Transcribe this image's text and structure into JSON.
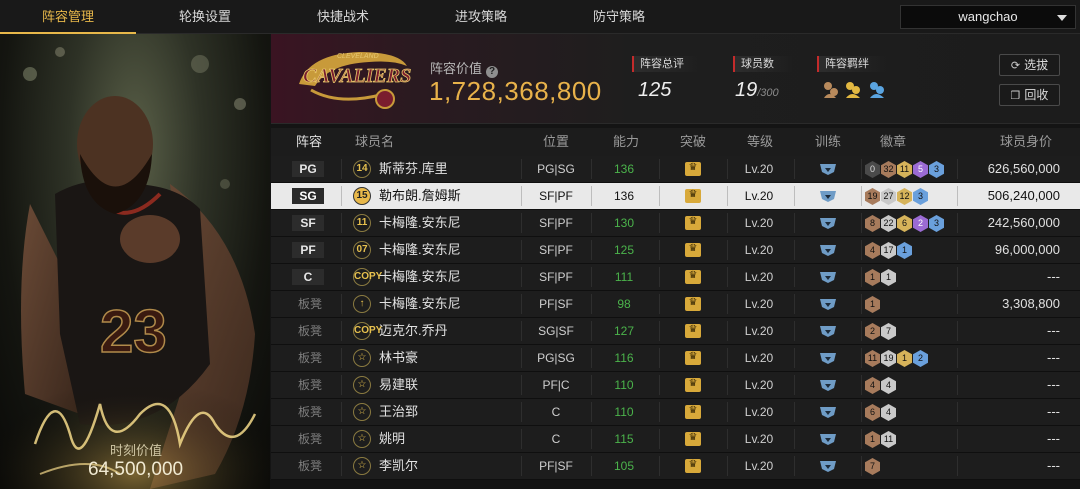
{
  "nav": {
    "tabs": [
      {
        "label": "阵容管理",
        "active": true
      },
      {
        "label": "轮换设置",
        "active": false
      },
      {
        "label": "快捷战术",
        "active": false
      },
      {
        "label": "进攻策略",
        "active": false
      },
      {
        "label": "防守策略",
        "active": false
      }
    ],
    "user": "wangchao"
  },
  "card": {
    "jersey_number": "23",
    "value_label": "时刻价值",
    "value": "64,500,000"
  },
  "header": {
    "team_logo_text": "CAVALIERS",
    "team_logo_subtext": "CLEVELAND",
    "lineup_value_label": "阵容价值",
    "lineup_value": "1,728,368,800",
    "stats": [
      {
        "label": "阵容总评",
        "value": "125",
        "suffix": ""
      },
      {
        "label": "球员数",
        "value": "19",
        "suffix": "/300"
      },
      {
        "label": "阵容羁绊",
        "value": "",
        "suffix": ""
      }
    ],
    "buttons": {
      "select": "选拔",
      "recycle": "回收"
    }
  },
  "table": {
    "headers": [
      "阵容",
      "球员名",
      "位置",
      "能力",
      "突破",
      "等级",
      "训练",
      "徽章",
      "球员身价"
    ],
    "rows": [
      {
        "slot": "PG",
        "starter": true,
        "jersey": "14",
        "name": "斯蒂芬.库里",
        "pos": "PG|SG",
        "rating": "136",
        "level": "Lv.20",
        "badges": [
          [
            "b-dark",
            "0"
          ],
          [
            "b-bronze",
            "32"
          ],
          [
            "b-gold",
            "11"
          ],
          [
            "b-purple",
            "5"
          ],
          [
            "b-blue",
            "3"
          ]
        ],
        "salary": "626,560,000",
        "selected": false
      },
      {
        "slot": "SG",
        "starter": true,
        "jersey": "15",
        "name": "勒布朗.詹姆斯",
        "pos": "SF|PF",
        "rating": "136",
        "level": "Lv.20",
        "badges": [
          [
            "b-bronze",
            "19"
          ],
          [
            "b-silver",
            "27"
          ],
          [
            "b-gold",
            "12"
          ],
          [
            "b-blue",
            "3"
          ]
        ],
        "salary": "506,240,000",
        "selected": true
      },
      {
        "slot": "SF",
        "starter": true,
        "jersey": "11",
        "name": "卡梅隆.安东尼",
        "pos": "SF|PF",
        "rating": "130",
        "level": "Lv.20",
        "badges": [
          [
            "b-bronze",
            "8"
          ],
          [
            "b-silver",
            "22"
          ],
          [
            "b-gold",
            "6"
          ],
          [
            "b-purple",
            "2"
          ],
          [
            "b-blue",
            "3"
          ]
        ],
        "salary": "242,560,000",
        "selected": false
      },
      {
        "slot": "PF",
        "starter": true,
        "jersey": "07",
        "name": "卡梅隆.安东尼",
        "pos": "SF|PF",
        "rating": "125",
        "level": "Lv.20",
        "badges": [
          [
            "b-bronze",
            "4"
          ],
          [
            "b-silver",
            "17"
          ],
          [
            "b-blue",
            "1"
          ]
        ],
        "salary": "96,000,000",
        "selected": false
      },
      {
        "slot": "C",
        "starter": true,
        "jersey": "COPY",
        "name": "卡梅隆.安东尼",
        "pos": "SF|PF",
        "rating": "111",
        "level": "Lv.20",
        "badges": [
          [
            "b-bronze",
            "1"
          ],
          [
            "b-silver",
            "1"
          ]
        ],
        "salary": "---",
        "selected": false
      },
      {
        "slot": "板凳",
        "starter": false,
        "jersey": "↑",
        "name": "卡梅隆.安东尼",
        "pos": "PF|SF",
        "rating": "98",
        "level": "Lv.20",
        "badges": [
          [
            "b-bronze",
            "1"
          ]
        ],
        "salary": "3,308,800",
        "selected": false
      },
      {
        "slot": "板凳",
        "starter": false,
        "jersey": "COPY",
        "name": "迈克尔.乔丹",
        "pos": "SG|SF",
        "rating": "127",
        "level": "Lv.20",
        "badges": [
          [
            "b-bronze",
            "2"
          ],
          [
            "b-silver",
            "7"
          ]
        ],
        "salary": "---",
        "selected": false
      },
      {
        "slot": "板凳",
        "starter": false,
        "jersey": "☆",
        "name": "林书豪",
        "pos": "PG|SG",
        "rating": "116",
        "level": "Lv.20",
        "badges": [
          [
            "b-bronze",
            "11"
          ],
          [
            "b-silver",
            "19"
          ],
          [
            "b-gold",
            "1"
          ],
          [
            "b-blue",
            "2"
          ]
        ],
        "salary": "---",
        "selected": false
      },
      {
        "slot": "板凳",
        "starter": false,
        "jersey": "☆",
        "name": "易建联",
        "pos": "PF|C",
        "rating": "110",
        "level": "Lv.20",
        "badges": [
          [
            "b-bronze",
            "4"
          ],
          [
            "b-silver",
            "4"
          ]
        ],
        "salary": "---",
        "selected": false
      },
      {
        "slot": "板凳",
        "starter": false,
        "jersey": "☆",
        "name": "王治郅",
        "pos": "C",
        "rating": "110",
        "level": "Lv.20",
        "badges": [
          [
            "b-bronze",
            "6"
          ],
          [
            "b-silver",
            "4"
          ]
        ],
        "salary": "---",
        "selected": false
      },
      {
        "slot": "板凳",
        "starter": false,
        "jersey": "☆",
        "name": "姚明",
        "pos": "C",
        "rating": "115",
        "level": "Lv.20",
        "badges": [
          [
            "b-bronze",
            "1"
          ],
          [
            "b-silver",
            "11"
          ]
        ],
        "salary": "---",
        "selected": false
      },
      {
        "slot": "板凳",
        "starter": false,
        "jersey": "☆",
        "name": "李凯尔",
        "pos": "PF|SF",
        "rating": "105",
        "level": "Lv.20",
        "badges": [
          [
            "b-bronze",
            "7"
          ]
        ],
        "salary": "---",
        "selected": false
      }
    ]
  }
}
